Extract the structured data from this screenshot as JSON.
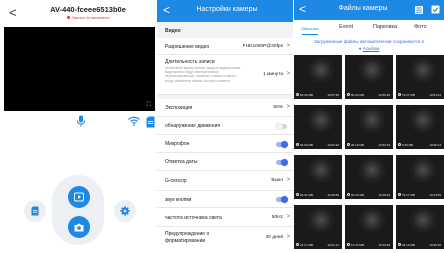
{
  "live": {
    "back_label": "<",
    "title": "AV-440-fceee6513b0e",
    "status": "Запись остановлена",
    "fullscreen_glyph": "⛶",
    "icons": [
      "back-icon",
      "fullscreen-icon",
      "microphone-icon",
      "wifi-icon",
      "sd-card-icon",
      "play-icon",
      "camera-icon",
      "sd-card-icon",
      "gear-icon"
    ]
  },
  "settings": {
    "back_label": "<",
    "title": "Настройки камеры",
    "section_video": "Видео",
    "resolution": {
      "label": "Разрешение видео",
      "value": "FHD1080P@30fps"
    },
    "record_length": {
      "label": "Длительность записи",
      "desc": "Установите время записи каждого видеоролика. Видеоклипы будут автоматически перезаписываться, начиная с самого старого, когда заполнена память на карте памяти",
      "value": "1 минута"
    },
    "exposure": {
      "label": "Экспозиция",
      "value": "50%"
    },
    "motion": {
      "label": "обнаружение движения",
      "toggle": "off"
    },
    "microphone": {
      "label": "Микрофон",
      "toggle": "on"
    },
    "date_stamp": {
      "label": "Отметка даты",
      "toggle": "on"
    },
    "gsensor": {
      "label": "G-сенсор",
      "value": "Выкл"
    },
    "button_sound": {
      "label": "звук кнопки",
      "toggle": "on"
    },
    "light_freq": {
      "label": "частота источника света",
      "value": "50Hz"
    },
    "format_warning": {
      "label": "Предупреждение о форматировании",
      "value": "30 дней"
    },
    "chevron": ">",
    "accent_color": "#1e88e5"
  },
  "files": {
    "back_label": "<",
    "title": "Файлы камеры",
    "tabs": [
      "Обычные",
      "Event",
      "Парковка",
      "Фото"
    ],
    "note_line1": "Загруженные файлы автоматически сохраняются в",
    "note_link": "Альбом",
    "thumbs": [
      {
        "size": "60.36 MB",
        "time": "10:57:59"
      },
      {
        "size": "60.34 MB",
        "time": "10:56:39"
      },
      {
        "size": "79.37 MB",
        "time": "10:54:24"
      },
      {
        "size": "36.00 MB",
        "time": "10:52:34"
      },
      {
        "size": "36.19 MB",
        "time": "10:52:23"
      },
      {
        "size": "8.30 MB",
        "time": "10:06:14"
      },
      {
        "size": "60.31 MB",
        "time": "10:49:59"
      },
      {
        "size": "60.34 MB",
        "time": "10:48:34"
      },
      {
        "size": "70.17 MB",
        "time": "10:44:59"
      },
      {
        "size": "41.17 MB",
        "time": "10:41:14"
      },
      {
        "size": "13.33 MB",
        "time": "10:40:28"
      },
      {
        "size": "36.19 MB",
        "time": "10:35:36"
      }
    ]
  }
}
